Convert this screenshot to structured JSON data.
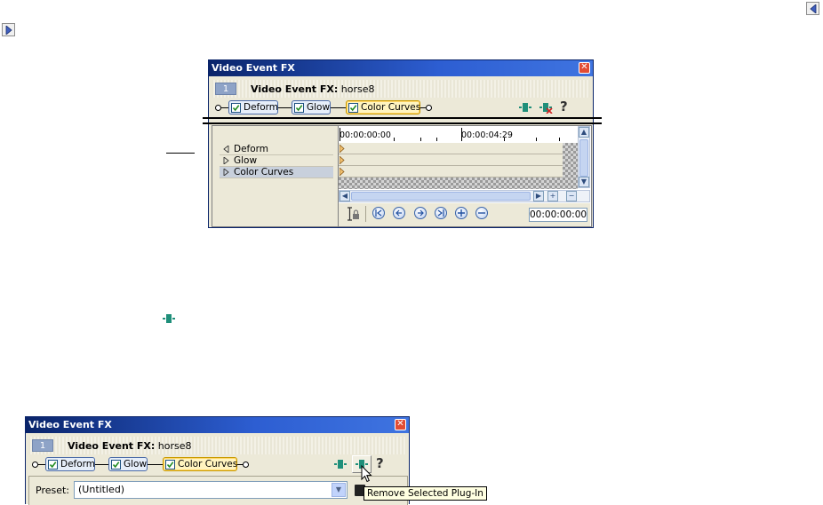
{
  "nav": {
    "prev_icon": "triangle-left-icon",
    "next_icon": "triangle-right-icon"
  },
  "window1": {
    "title": "Video Event FX",
    "close_icon": "close-icon",
    "event_number": "1",
    "header_label": "Video Event FX:",
    "header_value": "horse8",
    "chain": [
      {
        "label": "Deform",
        "checked": true,
        "active": false
      },
      {
        "label": "Glow",
        "checked": true,
        "active": false
      },
      {
        "label": "Color Curves",
        "checked": true,
        "active": true
      }
    ],
    "toolbar_icons": [
      "plugin-chain-icon",
      "remove-plugin-icon"
    ],
    "help_label": "?",
    "tracks": [
      {
        "label": "Deform",
        "expanded": true,
        "selected": false
      },
      {
        "label": "Glow",
        "expanded": false,
        "selected": false
      },
      {
        "label": "Color Curves",
        "expanded": false,
        "selected": true
      }
    ],
    "ruler": {
      "start": "00:00:00:00",
      "mid": "00:00:04:29"
    },
    "time_display": "00:00:00:00"
  },
  "window2": {
    "title": "Video Event FX",
    "close_icon": "close-icon",
    "event_number": "1",
    "header_label": "Video Event FX:",
    "header_value": "horse8",
    "chain": [
      {
        "label": "Deform",
        "checked": true,
        "active": false
      },
      {
        "label": "Glow",
        "checked": true,
        "active": false
      },
      {
        "label": "Color Curves",
        "checked": true,
        "active": true
      }
    ],
    "help_label": "?",
    "preset_label": "Preset:",
    "preset_value": "(Untitled)",
    "tooltip": "Remove Selected Plug-In"
  },
  "colors": {
    "titlebar": "#0a246a",
    "dialog_bg": "#ece9d8",
    "plugin_icon": "#1f8f7a",
    "active_fx": "#fff4bf"
  }
}
